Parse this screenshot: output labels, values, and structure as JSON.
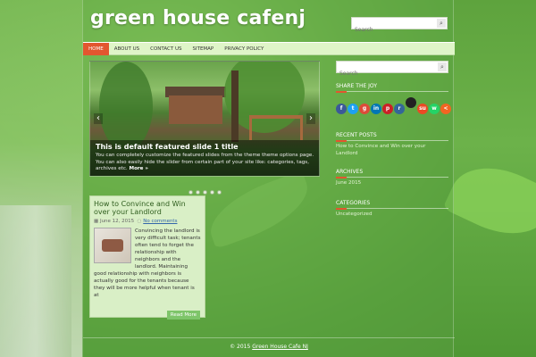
{
  "site": {
    "title": "green house cafenj"
  },
  "header_search": {
    "placeholder": "Search"
  },
  "nav": {
    "items": [
      "HOME",
      "ABOUT US",
      "CONTACT US",
      "SITEMAP",
      "PRIVACY POLICY"
    ]
  },
  "slider": {
    "title": "This is default featured slide 1 title",
    "text": "You can completely customize the featured slides from the theme theme options page. You can also easily hide the slider from certain part of your site like: categories, tags, archives etc.",
    "more": "More »",
    "prev": "‹",
    "next": "›"
  },
  "post": {
    "title": "How to Convince and Win over your Landlord",
    "date": "June 12, 2015",
    "comments": "No comments",
    "body": "Convincing the landlord is very difficult task; tenants often tend to forget the relationship with neighbors and the landlord. Maintaining good relationship with neighbors is actually good for the tenants because they will be more helpful when tenant is at",
    "read_more": "Read More"
  },
  "sidebar": {
    "search_placeholder": "Search",
    "share_title": "SHARE THE JOY",
    "recent_title": "RECENT POSTS",
    "recent_link": "How to Convince and Win over your Landlord",
    "archives_title": "ARCHIVES",
    "archives_link": "June 2015",
    "categories_title": "CATEGORIES",
    "categories_link": "Uncategorized"
  },
  "social": [
    {
      "icon": "facebook-icon",
      "glyph": "f",
      "color": "#3b5998"
    },
    {
      "icon": "twitter-icon",
      "glyph": "t",
      "color": "#1da1f2"
    },
    {
      "icon": "google-plus-icon",
      "glyph": "g",
      "color": "#dd4b39"
    },
    {
      "icon": "linkedin-icon",
      "glyph": "in",
      "color": "#0077b5"
    },
    {
      "icon": "pinterest-icon",
      "glyph": "p",
      "color": "#cb2027"
    },
    {
      "icon": "reddit-icon",
      "glyph": "r",
      "color": "#336699"
    },
    {
      "icon": "delicious-icon",
      "glyph": "",
      "color": "#222222"
    },
    {
      "icon": "stumbleupon-icon",
      "glyph": "su",
      "color": "#eb4924"
    },
    {
      "icon": "whatsapp-icon",
      "glyph": "w",
      "color": "#25d366"
    },
    {
      "icon": "share-icon",
      "glyph": "<",
      "color": "#f26522"
    }
  ],
  "footer": {
    "prefix": "© 2015",
    "link": "Green House Cafe NJ"
  },
  "colors": {
    "accent": "#e2562f",
    "nav_bg": "#dff5c8",
    "post_bg": "#d9efc6"
  }
}
